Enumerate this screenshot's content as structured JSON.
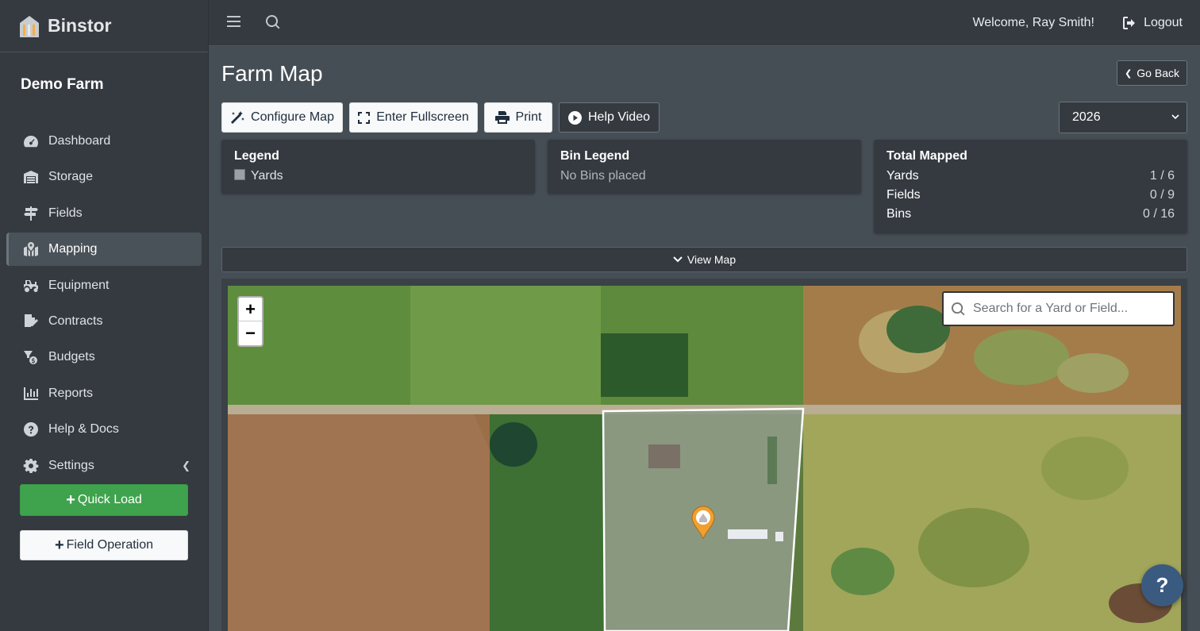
{
  "brand": {
    "name": "Binstor"
  },
  "farm": {
    "name": "Demo Farm"
  },
  "sidebar": {
    "items": [
      {
        "label": "Dashboard",
        "icon": "dashboard-icon"
      },
      {
        "label": "Storage",
        "icon": "warehouse-icon"
      },
      {
        "label": "Fields",
        "icon": "signpost-icon"
      },
      {
        "label": "Mapping",
        "icon": "map-marked-icon",
        "active": true
      },
      {
        "label": "Equipment",
        "icon": "tractor-icon"
      },
      {
        "label": "Contracts",
        "icon": "file-signature-icon"
      },
      {
        "label": "Budgets",
        "icon": "coins-icon"
      },
      {
        "label": "Reports",
        "icon": "chart-bar-icon"
      },
      {
        "label": "Help & Docs",
        "icon": "question-circle-icon"
      },
      {
        "label": "Settings",
        "icon": "gear-icon"
      }
    ],
    "quick_load": "Quick Load",
    "field_operation": "Field Operation"
  },
  "topbar": {
    "welcome": "Welcome, Ray Smith!",
    "logout": "Logout"
  },
  "page": {
    "title": "Farm Map",
    "go_back": "Go Back"
  },
  "toolbar": {
    "configure_map": "Configure Map",
    "fullscreen": "Enter Fullscreen",
    "print": "Print",
    "help_video": "Help Video",
    "year": "2026"
  },
  "legend": {
    "title": "Legend",
    "items": [
      "Yards"
    ]
  },
  "bin_legend": {
    "title": "Bin Legend",
    "empty_text": "No Bins placed"
  },
  "total_mapped": {
    "title": "Total Mapped",
    "rows": [
      {
        "label": "Yards",
        "value": "1 / 6"
      },
      {
        "label": "Fields",
        "value": "0 / 9"
      },
      {
        "label": "Bins",
        "value": "0 / 16"
      }
    ]
  },
  "view_map": "View Map",
  "map": {
    "zoom_in": "+",
    "zoom_out": "−",
    "search_placeholder": "Search for a Yard or Field..."
  },
  "help_fab": "?",
  "colors": {
    "sidebar_bg": "#343a40",
    "content_bg": "#454d55",
    "quick_load_green": "#3fa34d",
    "marker_orange": "#f0a030"
  }
}
